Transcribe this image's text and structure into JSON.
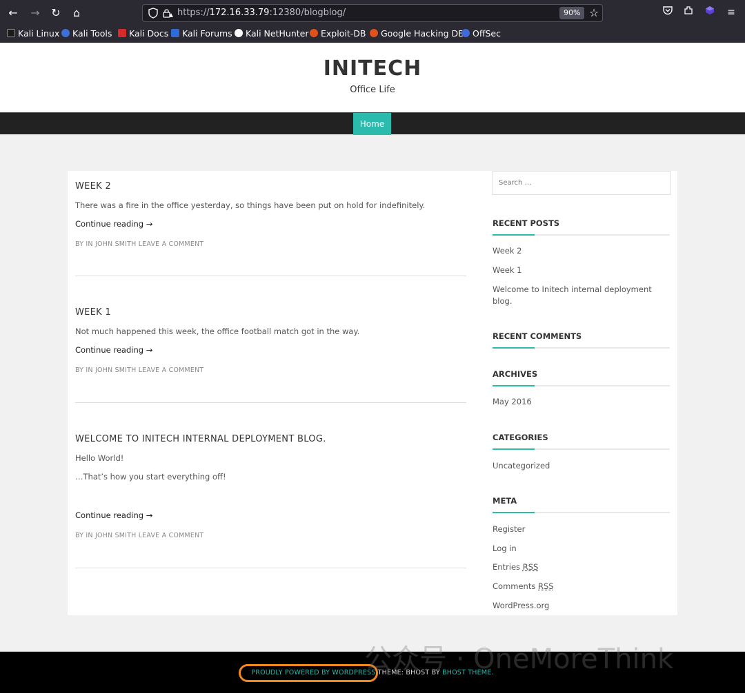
{
  "browser": {
    "url_proto": "https://",
    "url_host": "172.16.33.79",
    "url_rest": ":12380/blogblog/",
    "zoom": "90%",
    "bookmarks": [
      "Kali Linux",
      "Kali Tools",
      "Kali Docs",
      "Kali Forums",
      "Kali NetHunter",
      "Exploit-DB",
      "Google Hacking DB",
      "OffSec"
    ]
  },
  "site": {
    "title": "INITECH",
    "description": "Office Life",
    "nav_home": "Home"
  },
  "posts": [
    {
      "title": "WEEK 2",
      "paragraphs": [
        "There was a fire in the office yesterday, so things have been put on hold for indefinitely."
      ],
      "more": "Continue reading →",
      "meta": "BY IN JOHN SMITH LEAVE A COMMENT"
    },
    {
      "title": "WEEK 1",
      "paragraphs": [
        "Not much happened this week, the office football match got in the way."
      ],
      "more": "Continue reading →",
      "meta": "BY IN JOHN SMITH LEAVE A COMMENT"
    },
    {
      "title": "WELCOME TO INITECH INTERNAL DEPLOYMENT BLOG.",
      "paragraphs": [
        "Hello World!",
        "…That’s how you start everything off!"
      ],
      "more": "Continue reading →",
      "meta": "BY IN JOHN SMITH LEAVE A COMMENT"
    }
  ],
  "sidebar": {
    "search_placeholder": "Search …",
    "recent_posts_title": "RECENT POSTS",
    "recent_posts": [
      "Week 2",
      "Week 1",
      "Welcome to Initech internal deployment blog."
    ],
    "recent_comments_title": "RECENT COMMENTS",
    "archives_title": "ARCHIVES",
    "archives": [
      "May 2016"
    ],
    "categories_title": "CATEGORIES",
    "categories": [
      "Uncategorized"
    ],
    "meta_title": "META",
    "meta_register": "Register",
    "meta_login": "Log in",
    "meta_entries": "Entries",
    "meta_comments": "Comments",
    "meta_rss": "RSS",
    "meta_wordpress": "WordPress.org"
  },
  "footer": {
    "powered": "PROUDLY POWERED BY WORDPRESS",
    "theme_prefix": "THEME: BHOST BY",
    "theme_link": "BHOST THEME",
    "theme_suffix": "."
  },
  "watermark": "公众号 · OneMoreThink",
  "colors": {
    "accent": "#2bbbad",
    "highlight": "#f0881d",
    "chrome": "#2b2a33"
  }
}
